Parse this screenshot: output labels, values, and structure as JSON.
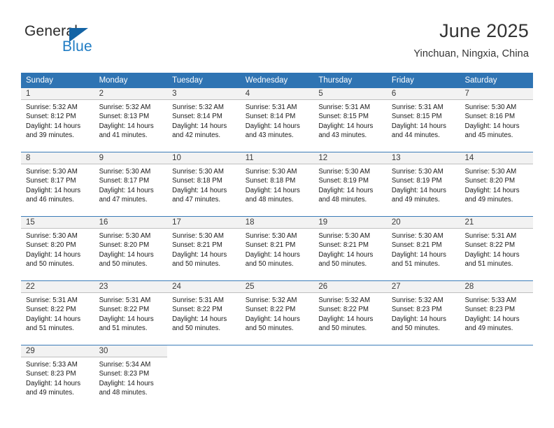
{
  "logo": {
    "word_one": "General",
    "word_two": "Blue",
    "triangle_icon": "triangle-icon",
    "brand_blue": "#1f7cc4",
    "triangle_color": "#1464a5"
  },
  "header": {
    "title": "June 2025",
    "subtitle": "Yinchuan, Ningxia, China"
  },
  "calendar": {
    "header_bg": "#2f74b3",
    "header_text_color": "#ffffff",
    "day_number_bg": "#f2f2f2",
    "weekdays": [
      "Sunday",
      "Monday",
      "Tuesday",
      "Wednesday",
      "Thursday",
      "Friday",
      "Saturday"
    ],
    "weeks": [
      [
        {
          "day": "1",
          "lines": [
            "Sunrise: 5:32 AM",
            "Sunset: 8:12 PM",
            "Daylight: 14 hours",
            "and 39 minutes."
          ]
        },
        {
          "day": "2",
          "lines": [
            "Sunrise: 5:32 AM",
            "Sunset: 8:13 PM",
            "Daylight: 14 hours",
            "and 41 minutes."
          ]
        },
        {
          "day": "3",
          "lines": [
            "Sunrise: 5:32 AM",
            "Sunset: 8:14 PM",
            "Daylight: 14 hours",
            "and 42 minutes."
          ]
        },
        {
          "day": "4",
          "lines": [
            "Sunrise: 5:31 AM",
            "Sunset: 8:14 PM",
            "Daylight: 14 hours",
            "and 43 minutes."
          ]
        },
        {
          "day": "5",
          "lines": [
            "Sunrise: 5:31 AM",
            "Sunset: 8:15 PM",
            "Daylight: 14 hours",
            "and 43 minutes."
          ]
        },
        {
          "day": "6",
          "lines": [
            "Sunrise: 5:31 AM",
            "Sunset: 8:15 PM",
            "Daylight: 14 hours",
            "and 44 minutes."
          ]
        },
        {
          "day": "7",
          "lines": [
            "Sunrise: 5:30 AM",
            "Sunset: 8:16 PM",
            "Daylight: 14 hours",
            "and 45 minutes."
          ]
        }
      ],
      [
        {
          "day": "8",
          "lines": [
            "Sunrise: 5:30 AM",
            "Sunset: 8:17 PM",
            "Daylight: 14 hours",
            "and 46 minutes."
          ]
        },
        {
          "day": "9",
          "lines": [
            "Sunrise: 5:30 AM",
            "Sunset: 8:17 PM",
            "Daylight: 14 hours",
            "and 47 minutes."
          ]
        },
        {
          "day": "10",
          "lines": [
            "Sunrise: 5:30 AM",
            "Sunset: 8:18 PM",
            "Daylight: 14 hours",
            "and 47 minutes."
          ]
        },
        {
          "day": "11",
          "lines": [
            "Sunrise: 5:30 AM",
            "Sunset: 8:18 PM",
            "Daylight: 14 hours",
            "and 48 minutes."
          ]
        },
        {
          "day": "12",
          "lines": [
            "Sunrise: 5:30 AM",
            "Sunset: 8:19 PM",
            "Daylight: 14 hours",
            "and 48 minutes."
          ]
        },
        {
          "day": "13",
          "lines": [
            "Sunrise: 5:30 AM",
            "Sunset: 8:19 PM",
            "Daylight: 14 hours",
            "and 49 minutes."
          ]
        },
        {
          "day": "14",
          "lines": [
            "Sunrise: 5:30 AM",
            "Sunset: 8:20 PM",
            "Daylight: 14 hours",
            "and 49 minutes."
          ]
        }
      ],
      [
        {
          "day": "15",
          "lines": [
            "Sunrise: 5:30 AM",
            "Sunset: 8:20 PM",
            "Daylight: 14 hours",
            "and 50 minutes."
          ]
        },
        {
          "day": "16",
          "lines": [
            "Sunrise: 5:30 AM",
            "Sunset: 8:20 PM",
            "Daylight: 14 hours",
            "and 50 minutes."
          ]
        },
        {
          "day": "17",
          "lines": [
            "Sunrise: 5:30 AM",
            "Sunset: 8:21 PM",
            "Daylight: 14 hours",
            "and 50 minutes."
          ]
        },
        {
          "day": "18",
          "lines": [
            "Sunrise: 5:30 AM",
            "Sunset: 8:21 PM",
            "Daylight: 14 hours",
            "and 50 minutes."
          ]
        },
        {
          "day": "19",
          "lines": [
            "Sunrise: 5:30 AM",
            "Sunset: 8:21 PM",
            "Daylight: 14 hours",
            "and 50 minutes."
          ]
        },
        {
          "day": "20",
          "lines": [
            "Sunrise: 5:30 AM",
            "Sunset: 8:21 PM",
            "Daylight: 14 hours",
            "and 51 minutes."
          ]
        },
        {
          "day": "21",
          "lines": [
            "Sunrise: 5:31 AM",
            "Sunset: 8:22 PM",
            "Daylight: 14 hours",
            "and 51 minutes."
          ]
        }
      ],
      [
        {
          "day": "22",
          "lines": [
            "Sunrise: 5:31 AM",
            "Sunset: 8:22 PM",
            "Daylight: 14 hours",
            "and 51 minutes."
          ]
        },
        {
          "day": "23",
          "lines": [
            "Sunrise: 5:31 AM",
            "Sunset: 8:22 PM",
            "Daylight: 14 hours",
            "and 51 minutes."
          ]
        },
        {
          "day": "24",
          "lines": [
            "Sunrise: 5:31 AM",
            "Sunset: 8:22 PM",
            "Daylight: 14 hours",
            "and 50 minutes."
          ]
        },
        {
          "day": "25",
          "lines": [
            "Sunrise: 5:32 AM",
            "Sunset: 8:22 PM",
            "Daylight: 14 hours",
            "and 50 minutes."
          ]
        },
        {
          "day": "26",
          "lines": [
            "Sunrise: 5:32 AM",
            "Sunset: 8:22 PM",
            "Daylight: 14 hours",
            "and 50 minutes."
          ]
        },
        {
          "day": "27",
          "lines": [
            "Sunrise: 5:32 AM",
            "Sunset: 8:23 PM",
            "Daylight: 14 hours",
            "and 50 minutes."
          ]
        },
        {
          "day": "28",
          "lines": [
            "Sunrise: 5:33 AM",
            "Sunset: 8:23 PM",
            "Daylight: 14 hours",
            "and 49 minutes."
          ]
        }
      ],
      [
        {
          "day": "29",
          "lines": [
            "Sunrise: 5:33 AM",
            "Sunset: 8:23 PM",
            "Daylight: 14 hours",
            "and 49 minutes."
          ]
        },
        {
          "day": "30",
          "lines": [
            "Sunrise: 5:34 AM",
            "Sunset: 8:23 PM",
            "Daylight: 14 hours",
            "and 48 minutes."
          ]
        },
        {
          "day": "",
          "lines": []
        },
        {
          "day": "",
          "lines": []
        },
        {
          "day": "",
          "lines": []
        },
        {
          "day": "",
          "lines": []
        },
        {
          "day": "",
          "lines": []
        }
      ]
    ]
  }
}
